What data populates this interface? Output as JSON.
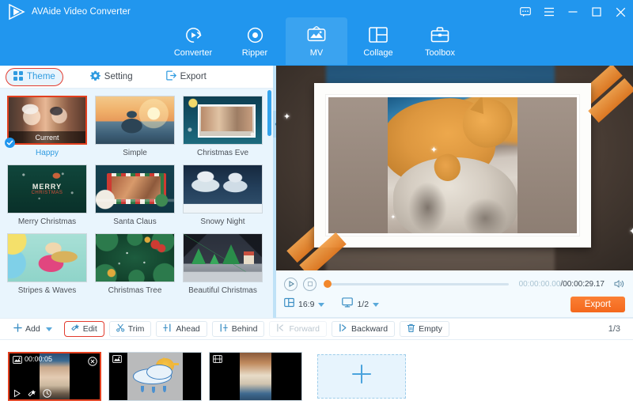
{
  "app": {
    "title": "AVAide Video Converter",
    "logo_icon": "play-triangle-logo"
  },
  "titlebar": {
    "buttons": [
      {
        "name": "feedback-icon",
        "glyph": "feedback"
      },
      {
        "name": "menu-icon",
        "glyph": "hamburger"
      },
      {
        "name": "minimize-icon",
        "glyph": "minimize"
      },
      {
        "name": "maximize-icon",
        "glyph": "maximize"
      },
      {
        "name": "close-icon",
        "glyph": "close"
      }
    ]
  },
  "nav": {
    "tabs": [
      {
        "label": "Converter",
        "icon": "converter-icon",
        "active": false
      },
      {
        "label": "Ripper",
        "icon": "ripper-icon",
        "active": false
      },
      {
        "label": "MV",
        "icon": "mv-icon",
        "active": true
      },
      {
        "label": "Collage",
        "icon": "collage-icon",
        "active": false
      },
      {
        "label": "Toolbox",
        "icon": "toolbox-icon",
        "active": false
      }
    ]
  },
  "subtabs": [
    {
      "label": "Theme",
      "icon": "grid-icon",
      "active": true,
      "highlighted": true
    },
    {
      "label": "Setting",
      "icon": "gear-icon",
      "active": false,
      "highlighted": false
    },
    {
      "label": "Export",
      "icon": "export-icon",
      "active": false,
      "highlighted": false
    }
  ],
  "themes": [
    {
      "label": "Happy",
      "selected": true,
      "badge": "Current"
    },
    {
      "label": "Simple",
      "selected": false,
      "badge": ""
    },
    {
      "label": "Christmas Eve",
      "selected": false,
      "badge": ""
    },
    {
      "label": "Merry Christmas",
      "selected": false,
      "badge": ""
    },
    {
      "label": "Santa Claus",
      "selected": false,
      "badge": ""
    },
    {
      "label": "Snowy Night",
      "selected": false,
      "badge": ""
    },
    {
      "label": "Stripes & Waves",
      "selected": false,
      "badge": ""
    },
    {
      "label": "Christmas Tree",
      "selected": false,
      "badge": ""
    },
    {
      "label": "Beautiful Christmas",
      "selected": false,
      "badge": ""
    }
  ],
  "player": {
    "play_icon": "play-icon",
    "stop_icon": "stop-icon",
    "current_time": "00:00:00.00",
    "total_time": "/00:00:29.17",
    "volume_icon": "speaker-icon",
    "aspect_icon": "aspect-ratio-icon",
    "aspect_value": "16:9",
    "screen_icon": "monitor-icon",
    "screen_value": "1/2",
    "export_label": "Export"
  },
  "toolbar": {
    "buttons": [
      {
        "label": "Add",
        "icon": "plus-icon",
        "caret": true,
        "disabled": false,
        "highlighted": false
      },
      {
        "label": "Edit",
        "icon": "edit-wand-icon",
        "caret": false,
        "disabled": false,
        "highlighted": true
      },
      {
        "label": "Trim",
        "icon": "scissors-icon",
        "caret": false,
        "disabled": false,
        "highlighted": false
      },
      {
        "label": "Ahead",
        "icon": "insert-ahead-icon",
        "caret": false,
        "disabled": false,
        "highlighted": false
      },
      {
        "label": "Behind",
        "icon": "insert-behind-icon",
        "caret": false,
        "disabled": false,
        "highlighted": false
      },
      {
        "label": "Forward",
        "icon": "move-forward-icon",
        "caret": false,
        "disabled": true,
        "highlighted": false
      },
      {
        "label": "Backward",
        "icon": "move-backward-icon",
        "caret": false,
        "disabled": false,
        "highlighted": false
      },
      {
        "label": "Empty",
        "icon": "trash-icon",
        "caret": false,
        "disabled": false,
        "highlighted": false
      }
    ],
    "page_indicator": "1/3"
  },
  "storyboard": {
    "clips": [
      {
        "name": "clip-1",
        "badge_icon": "image-icon",
        "duration": "00:00:05",
        "selected": true,
        "close_icon": "close-circle-icon",
        "tools": [
          "play-icon",
          "edit-wand-icon",
          "clock-icon"
        ]
      },
      {
        "name": "clip-2",
        "badge_icon": "image-icon",
        "duration": "",
        "selected": false,
        "close_icon": "",
        "tools": []
      },
      {
        "name": "clip-3",
        "badge_icon": "film-icon",
        "duration": "",
        "selected": false,
        "close_icon": "",
        "tools": []
      }
    ],
    "add_button": {
      "name": "add-media-button",
      "icon": "plus-icon"
    }
  },
  "colors": {
    "brand_blue": "#2196ee",
    "accent_orange": "#f3681d",
    "highlight_red": "#e23b2e",
    "panel_blue": "#e9f5fd"
  }
}
